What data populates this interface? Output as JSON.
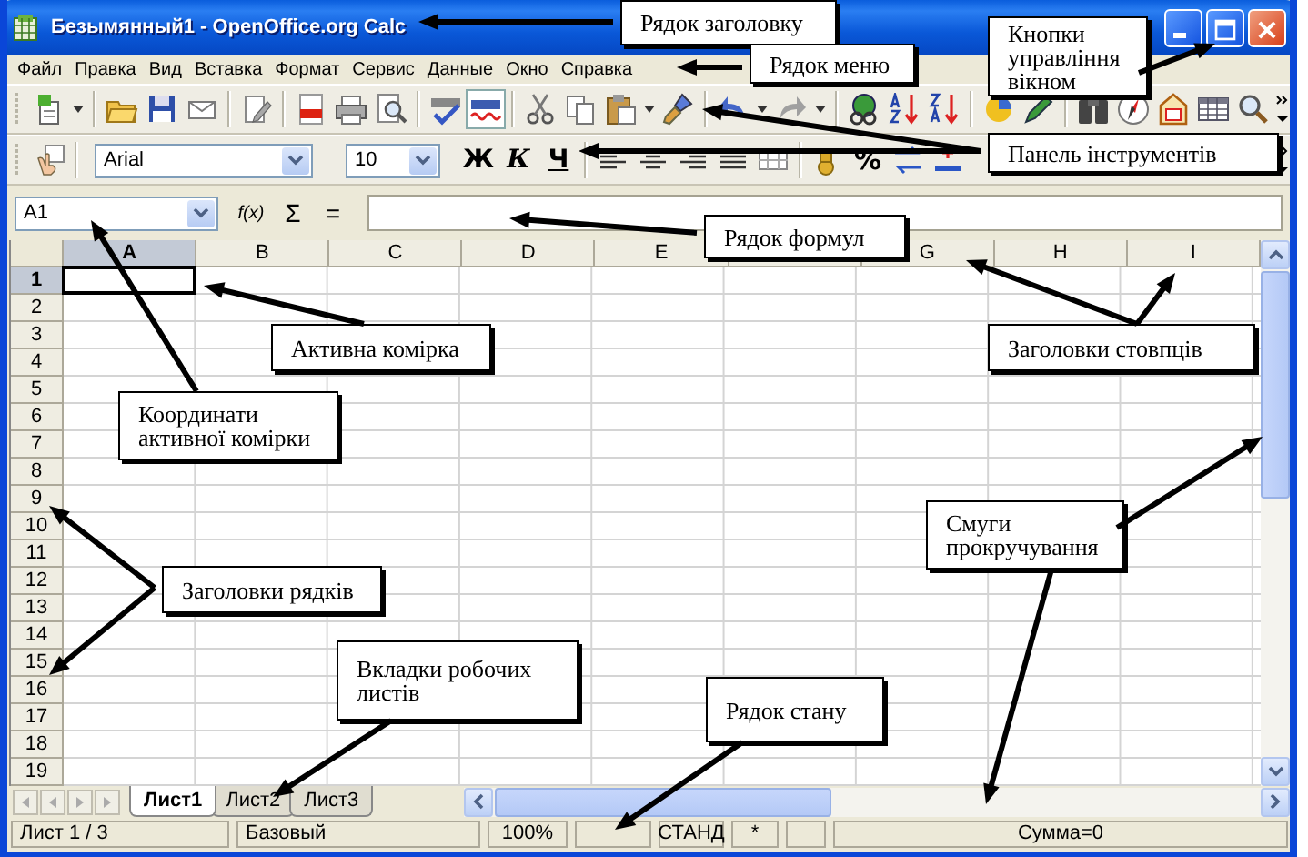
{
  "window": {
    "title": "Безымянный1 - OpenOffice.org Calc"
  },
  "menu": [
    "Файл",
    "Правка",
    "Вид",
    "Вставка",
    "Формат",
    "Сервис",
    "Данные",
    "Окно",
    "Справка"
  ],
  "format_toolbar": {
    "font": "Arial",
    "size": "10",
    "bold": "Ж",
    "italic": "К",
    "underline": "Ч",
    "percent": "%"
  },
  "formula_bar": {
    "cell": "A1",
    "function_wizard": "f(x)",
    "sum": "Σ",
    "equals": "="
  },
  "sheet": {
    "columns": [
      {
        "label": "A",
        "selected": true
      },
      {
        "label": "B",
        "selected": false
      },
      {
        "label": "C",
        "selected": false
      },
      {
        "label": "D",
        "selected": false
      },
      {
        "label": "E",
        "selected": false
      },
      {
        "selected": false
      },
      {
        "label": "G",
        "selected": false
      },
      {
        "label": "H",
        "selected": false
      },
      {
        "label": "I",
        "selected": false
      }
    ],
    "rows": [
      {
        "label": "1",
        "selected": true
      },
      {
        "label": "2",
        "selected": false
      },
      {
        "label": "3",
        "selected": false
      },
      {
        "label": "4",
        "selected": false
      },
      {
        "label": "5",
        "selected": false
      },
      {
        "label": "6",
        "selected": false
      },
      {
        "label": "7",
        "selected": false
      },
      {
        "label": "8",
        "selected": false
      },
      {
        "label": "9",
        "selected": false
      },
      {
        "label": "10",
        "selected": false
      },
      {
        "label": "11",
        "selected": false
      },
      {
        "label": "12",
        "selected": false
      },
      {
        "label": "13",
        "selected": false
      },
      {
        "label": "14",
        "selected": false
      },
      {
        "label": "15",
        "selected": false
      },
      {
        "label": "16",
        "selected": false
      },
      {
        "label": "17",
        "selected": false
      },
      {
        "label": "18",
        "selected": false
      },
      {
        "label": "19",
        "selected": false
      }
    ]
  },
  "sheet_tabs": [
    {
      "label": "Лист1",
      "selected": true
    },
    {
      "label": "Лист2",
      "selected": false
    },
    {
      "label": "Лист3",
      "selected": false
    }
  ],
  "status_bar": [
    "Лист 1 / 3",
    "Базовый",
    "100%",
    "СТАНД",
    "*",
    "Сумма=0"
  ],
  "callouts": [
    {
      "text": "Рядок заголовку"
    },
    {
      "text": "Рядок меню"
    },
    {
      "text": "Кнопки управління вікном"
    },
    {
      "text": "Панель інструментів"
    },
    {
      "text": "Рядок формул"
    },
    {
      "text": "Активна комірка"
    },
    {
      "text": "Координати активної комірки"
    },
    {
      "text": "Заголовки стовпців"
    },
    {
      "text": "Смуги прокручування"
    },
    {
      "text": "Заголовки рядків"
    },
    {
      "text": "Вкладки робочих листів"
    },
    {
      "text": "Рядок стану"
    }
  ]
}
